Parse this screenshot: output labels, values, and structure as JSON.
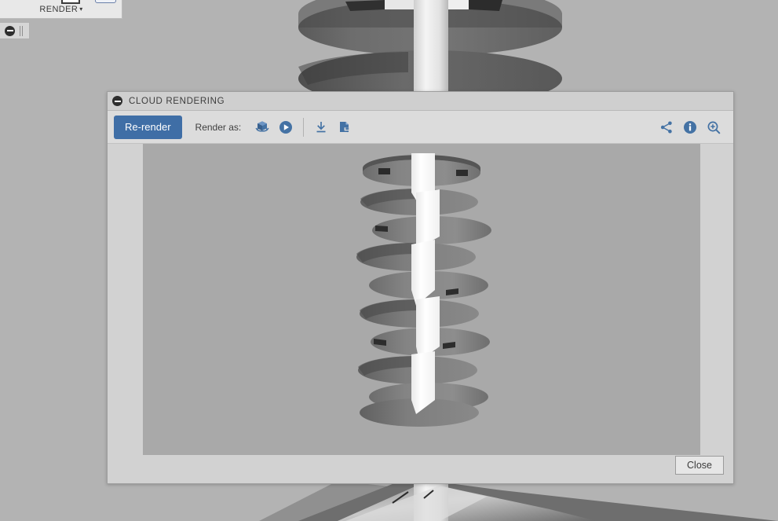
{
  "app": {
    "background_color": "#b3b3b3",
    "ribbon_tab_label": "RENDER",
    "ribbon_caret": "▾"
  },
  "mini_panel": {
    "collapse_icon": "circle-minus-icon",
    "grip_icon": "drag-handle-icon"
  },
  "dialog": {
    "title": "CLOUD RENDERING",
    "title_icon": "circle-minus-icon",
    "toolbar": {
      "rerender_label": "Re-render",
      "rerender_color": "#3f6ea6",
      "render_as_label": "Render as:",
      "options": [
        {
          "name": "3d-model-icon",
          "tooltip": "3D model"
        },
        {
          "name": "animation-play-icon",
          "tooltip": "Animation"
        }
      ],
      "actions": [
        {
          "name": "download-icon",
          "tooltip": "Download"
        },
        {
          "name": "file-export-icon",
          "tooltip": "Export"
        }
      ],
      "right_actions": [
        {
          "name": "share-icon",
          "tooltip": "Share"
        },
        {
          "name": "info-icon",
          "tooltip": "Info"
        },
        {
          "name": "zoom-in-icon",
          "tooltip": "Zoom in"
        }
      ],
      "icon_color": "#4472a4"
    },
    "viewport": {
      "background_color": "#a9a9a9",
      "subject": "helical-auger-screw",
      "shaft_color": "#fafafa",
      "blade_color": "#8c8c8c"
    },
    "footer": {
      "close_label": "Close"
    }
  }
}
